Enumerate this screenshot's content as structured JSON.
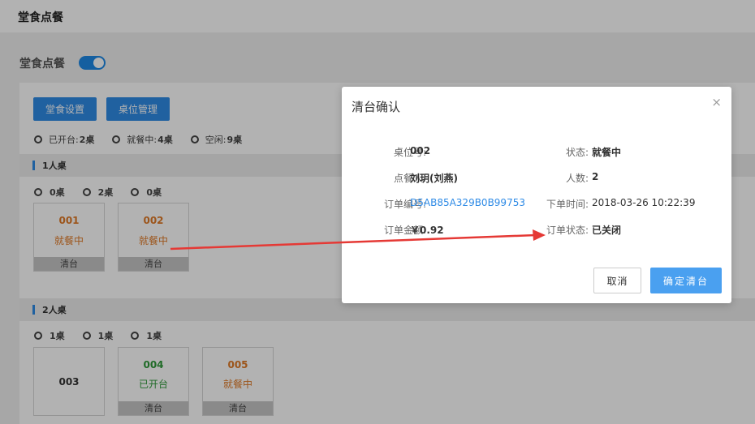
{
  "header": {
    "title": "堂食点餐"
  },
  "section": {
    "title": "堂食点餐",
    "toggle_on": true
  },
  "toolbar": {
    "settings_label": "堂食设置",
    "table_mgmt_label": "桌位管理"
  },
  "legend_summary": [
    {
      "label": "已开台:",
      "value": "2桌",
      "color": "green"
    },
    {
      "label": "就餐中:",
      "value": "4桌",
      "color": "orange"
    },
    {
      "label": "空闲:",
      "value": "9桌",
      "color": "gray"
    }
  ],
  "groups": [
    {
      "title": "1人桌",
      "counts": [
        "0桌",
        "2桌",
        "0桌"
      ],
      "tables": [
        {
          "num": "001",
          "status": "就餐中",
          "clear": "清台"
        },
        {
          "num": "002",
          "status": "就餐中",
          "clear": "清台"
        }
      ]
    },
    {
      "title": "2人桌",
      "counts": [
        "1桌",
        "1桌",
        "1桌"
      ],
      "tables": [
        {
          "num": "003",
          "status": "",
          "clear": ""
        },
        {
          "num": "004",
          "status": "已开台",
          "clear": "清台"
        },
        {
          "num": "005",
          "status": "就餐中",
          "clear": "清台"
        }
      ]
    }
  ],
  "modal": {
    "title": "清台确认",
    "close_icon": "×",
    "fields": {
      "table_no_label": "桌位号:",
      "table_no": "002",
      "status_label": "状态:",
      "status": "就餐中",
      "orderer_label": "点餐人:",
      "orderer": "刘玥(刘燕)",
      "people_label": "人数:",
      "people": "2",
      "order_no_label": "订单编号:",
      "order_no": "D5AB85A329B0B99753",
      "order_time_label": "下单时间:",
      "order_time": "2018-03-26 10:22:39",
      "amount_label": "订单金额:",
      "amount": "￥0.92",
      "order_status_label": "订单状态:",
      "order_status": "已关闭"
    },
    "cancel_label": "取消",
    "confirm_label": "确定清台"
  },
  "colors": {
    "accent": "#2f8be6",
    "green": "#2e9a3a",
    "orange": "#e07a27",
    "annotation_arrow": "#e53935"
  }
}
